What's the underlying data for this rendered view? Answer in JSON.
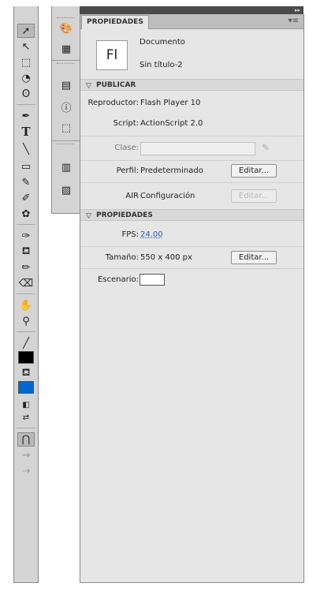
{
  "tools": {
    "collapse_arrows": "◂◂",
    "colors": {
      "stroke": "#000000",
      "fill": "#0066cc"
    }
  },
  "dock": {
    "collapse_arrows": "◂◂"
  },
  "properties_panel": {
    "collapse_arrows": "▸▸",
    "tab_label": "PROPIEDADES",
    "menu_glyph": "▾≡",
    "document": {
      "icon_text": "Fl",
      "type_label": "Documento",
      "name": "Sin título-2"
    },
    "publish_section": {
      "title": "PUBLICAR",
      "player_label": "Reproductor:",
      "player_value": "Flash Player 10",
      "script_label": "Script:",
      "script_value": "ActionScript 2.0",
      "class_label": "Clase:",
      "class_value": "",
      "profile_label": "Perfil:",
      "profile_value": "Predeterminado",
      "profile_edit_button": "Editar...",
      "air_label": "AIR",
      "air_value": "Configuración",
      "air_edit_button": "Editar..."
    },
    "properties_section": {
      "title": "PROPIEDADES",
      "fps_label": "FPS:",
      "fps_value": "24.00",
      "size_label": "Tamaño:",
      "size_value": "550 x 400 px",
      "size_edit_button": "Editar...",
      "stage_label": "Escenario:",
      "stage_color": "#ffffff"
    }
  }
}
